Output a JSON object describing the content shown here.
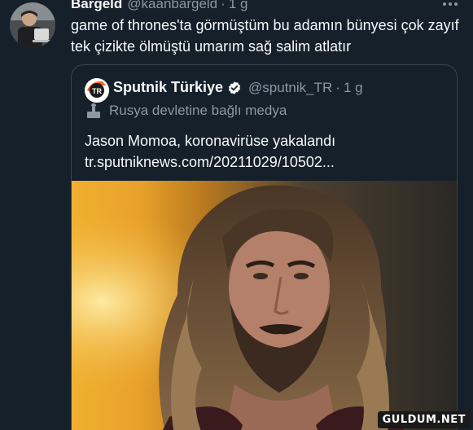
{
  "tweet": {
    "author_name": "Bargeld",
    "author_handle": "@kaanbargeld",
    "separator": "·",
    "time": "1 g",
    "text": "game of thrones'ta görmüştüm bu adamın bünyesi çok zayıf tek çizikte ölmüştü umarım sağ salim atlatır"
  },
  "quoted_tweet": {
    "author_name": "Sputnik Türkiye",
    "author_handle": "@sputnik_TR",
    "separator": "·",
    "time": "1 g",
    "avatar_text": "TR",
    "label": "Rusya devletine bağlı medya",
    "text": "Jason Momoa, koronavirüse yakalandı",
    "link": "tr.sputniknews.com/20211029/10502..."
  },
  "watermark": "GULDUM.NET",
  "colors": {
    "background": "#15202b",
    "border": "#38444d",
    "secondary_text": "#8b98a5",
    "verified": "#1d9bf0",
    "sputnik_orange": "#f26522"
  },
  "icons": {
    "more": "more-horizontal-icon",
    "verified": "verified-badge-icon",
    "state_media": "state-media-icon"
  }
}
